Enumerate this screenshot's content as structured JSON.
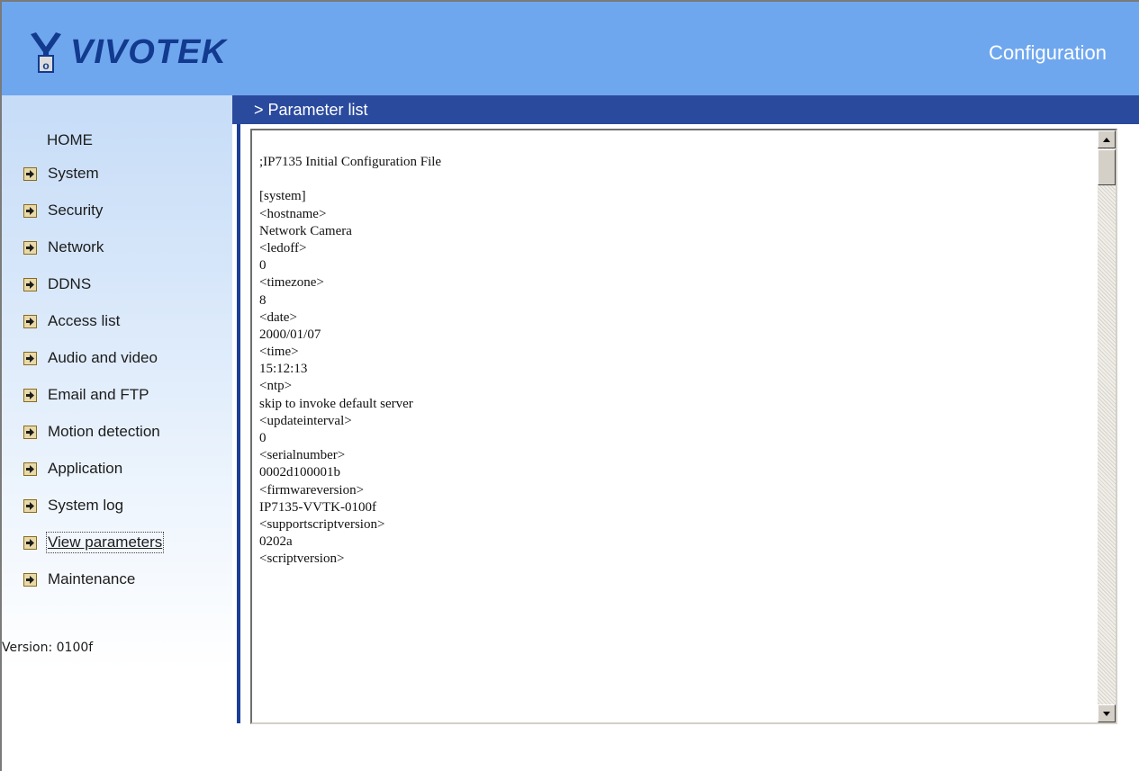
{
  "header": {
    "logo_text": "VIVOTEK",
    "title": "Configuration"
  },
  "sidebar": {
    "home_label": "HOME",
    "items": [
      {
        "label": "System",
        "icon": "arrow-right-icon"
      },
      {
        "label": "Security",
        "icon": "arrow-right-icon"
      },
      {
        "label": "Network",
        "icon": "arrow-right-icon"
      },
      {
        "label": "DDNS",
        "icon": "arrow-right-icon"
      },
      {
        "label": "Access list",
        "icon": "arrow-right-icon"
      },
      {
        "label": "Audio and video",
        "icon": "arrow-right-icon"
      },
      {
        "label": "Email and FTP",
        "icon": "arrow-right-icon"
      },
      {
        "label": "Motion detection",
        "icon": "arrow-right-icon"
      },
      {
        "label": "Application",
        "icon": "arrow-right-icon"
      },
      {
        "label": "System log",
        "icon": "arrow-right-icon"
      },
      {
        "label": "View parameters",
        "icon": "arrow-right-icon",
        "active": true
      },
      {
        "label": "Maintenance",
        "icon": "arrow-right-icon"
      }
    ],
    "version": "Version: 0100f"
  },
  "main": {
    "section_title": "> Parameter list",
    "parameter_lines": [
      ";IP7135 Initial Configuration File",
      "",
      "[system]",
      "<hostname>",
      "Network Camera",
      "<ledoff>",
      "0",
      "<timezone>",
      "8",
      "<date>",
      "2000/01/07",
      "<time>",
      "15:12:13",
      "<ntp>",
      "skip to invoke default server",
      "<updateinterval>",
      "0",
      "<serialnumber>",
      "0002d100001b",
      "<firmwareversion>",
      "IP7135-VVTK-0100f",
      "<supportscriptversion>",
      "0202a",
      "<scriptversion>"
    ]
  },
  "colors": {
    "header_bg": "#6fa7ef",
    "section_bar_bg": "#2a4a9e",
    "logo_color": "#123a8e"
  }
}
